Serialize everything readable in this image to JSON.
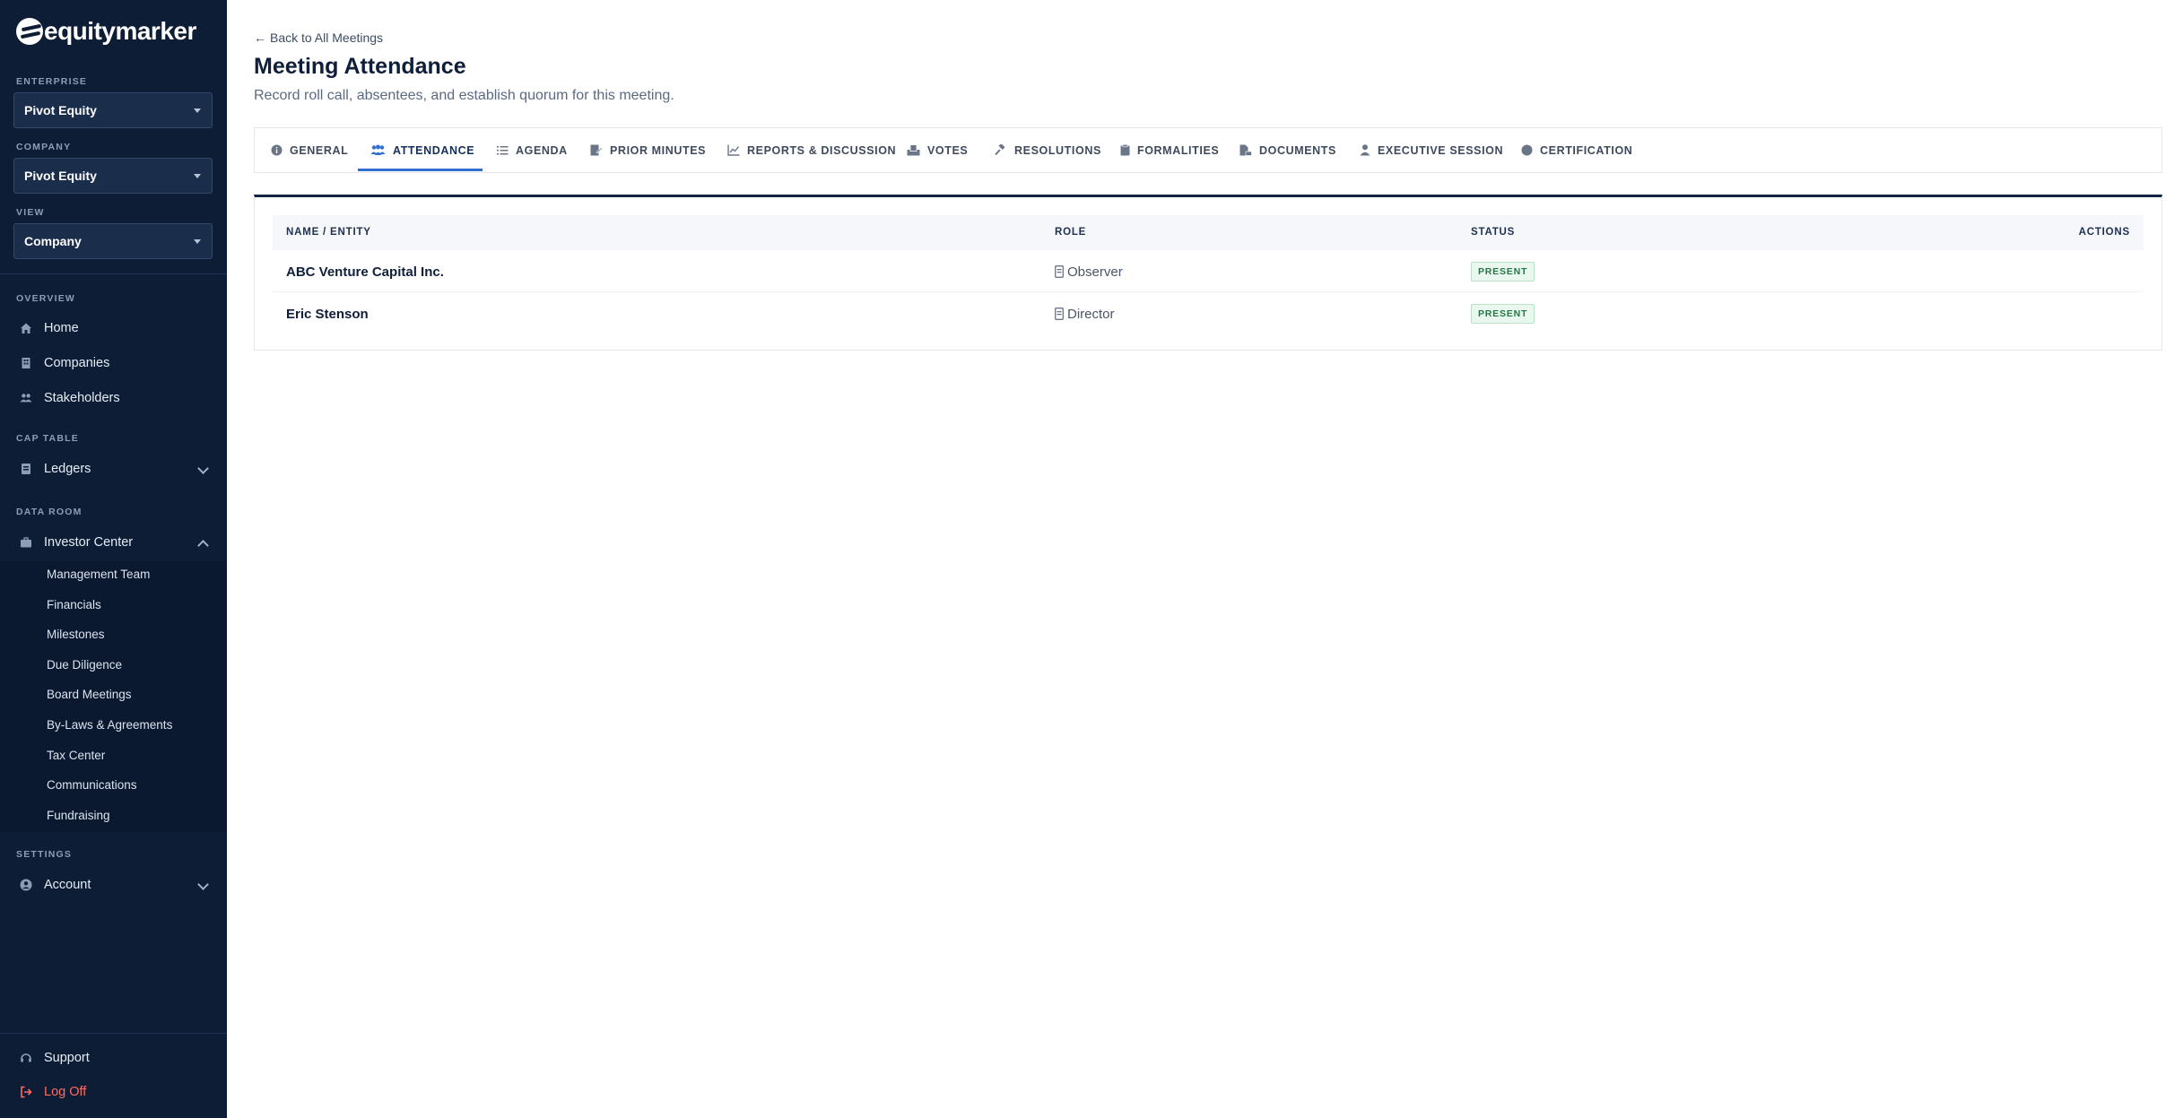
{
  "brand": {
    "name": "equitymarker"
  },
  "sidebar": {
    "enterprise": {
      "label": "ENTERPRISE",
      "value": "Pivot Equity"
    },
    "company": {
      "label": "COMPANY",
      "value": "Pivot Equity"
    },
    "view": {
      "label": "VIEW",
      "value": "Company"
    },
    "overview_label": "OVERVIEW",
    "overview": [
      "Home",
      "Companies",
      "Stakeholders"
    ],
    "cap_table_label": "CAP TABLE",
    "ledgers": "Ledgers",
    "data_room_label": "DATA ROOM",
    "investor_center": "Investor Center",
    "investor_sub": [
      "Management Team",
      "Financials",
      "Milestones",
      "Due Diligence",
      "Board Meetings",
      "By-Laws & Agreements",
      "Tax Center",
      "Communications",
      "Fundraising"
    ],
    "settings_label": "SETTINGS",
    "account": "Account",
    "support": "Support",
    "logoff": "Log Off"
  },
  "main": {
    "back": "Back to All Meetings",
    "title": "Meeting Attendance",
    "subtitle": "Record roll call, absentees, and establish quorum for this meeting.",
    "tabs": [
      "GENERAL",
      "ATTENDANCE",
      "AGENDA",
      "PRIOR MINUTES",
      "REPORTS & DISCUSSION",
      "VOTES",
      "RESOLUTIONS",
      "FORMALITIES",
      "DOCUMENTS",
      "EXECUTIVE SESSION",
      "CERTIFICATION"
    ],
    "active_tab": "ATTENDANCE",
    "table": {
      "headers": [
        "NAME / ENTITY",
        "ROLE",
        "STATUS",
        "ACTIONS"
      ],
      "rows": [
        {
          "name": "ABC Venture Capital Inc.",
          "role": "Observer",
          "status": "PRESENT"
        },
        {
          "name": "Eric Stenson",
          "role": "Director",
          "status": "PRESENT"
        }
      ]
    }
  },
  "colors": {
    "sidebar_bg": "#0d1d36",
    "accent": "#2f6fd1",
    "present": "#1f7a45",
    "logoff": "#ff6b5e"
  }
}
